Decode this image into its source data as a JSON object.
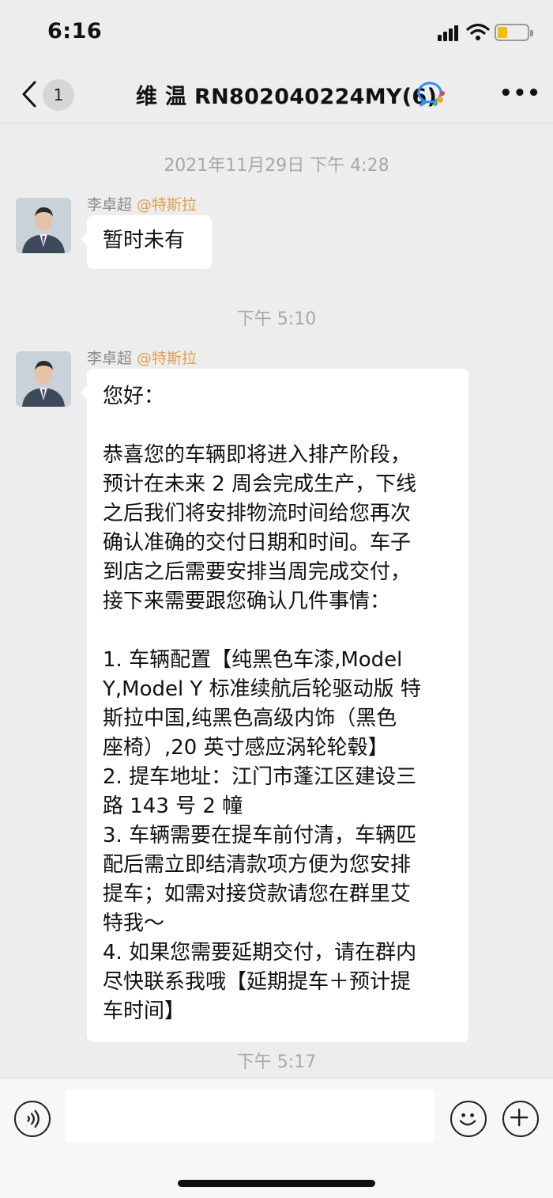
{
  "status": {
    "time": "6:16"
  },
  "nav": {
    "back_count": "1",
    "title": "维 温 RN802040224MY(6)"
  },
  "timestamps": [
    "2021年11月29日 下午 4:28",
    "下午 5:10",
    "下午 5:17"
  ],
  "messages": [
    {
      "sender": "李卓超",
      "org": "@特斯拉",
      "lines": [
        "暂时未有"
      ]
    },
    {
      "sender": "李卓超",
      "org": "@特斯拉",
      "lines": [
        "您好：",
        "",
        "恭喜您的车辆即将进入排产阶段，",
        "预计在未来 2 周会完成生产，下线",
        "之后我们将安排物流时间给您再次",
        "确认准确的交付日期和时间。车子",
        "到店之后需要安排当周完成交付，",
        "接下来需要跟您确认几件事情：",
        "",
        "1. 车辆配置【纯黑色车漆,Model",
        "Y,Model Y 标准续航后轮驱动版 特",
        "斯拉中国,纯黑色高级内饰（黑色",
        "座椅）,20 英寸感应涡轮轮毂】",
        "2. 提车地址：江门市蓬江区建设三",
        "路 143 号 2 幢",
        "3. 车辆需要在提车前付清，车辆匹",
        "配后需立即结清款项方便为您安排",
        "提车；如需对接贷款请您在群里艾",
        "特我～",
        "4. 如果您需要延期交付，请在群内",
        "尽快联系我哦【延期提车＋预计提",
        "车时间】"
      ]
    }
  ],
  "icons": {
    "back": "chevron-left-icon",
    "more": "more-dots-icon",
    "voice": "voice-icon",
    "emoji": "emoji-icon",
    "plus": "plus-icon",
    "group": "group-chat-icon"
  },
  "colors": {
    "background": "#ededed",
    "bubble": "#ffffff",
    "org_tag": "#e0a14a",
    "timestamp": "#a8a8a8"
  }
}
